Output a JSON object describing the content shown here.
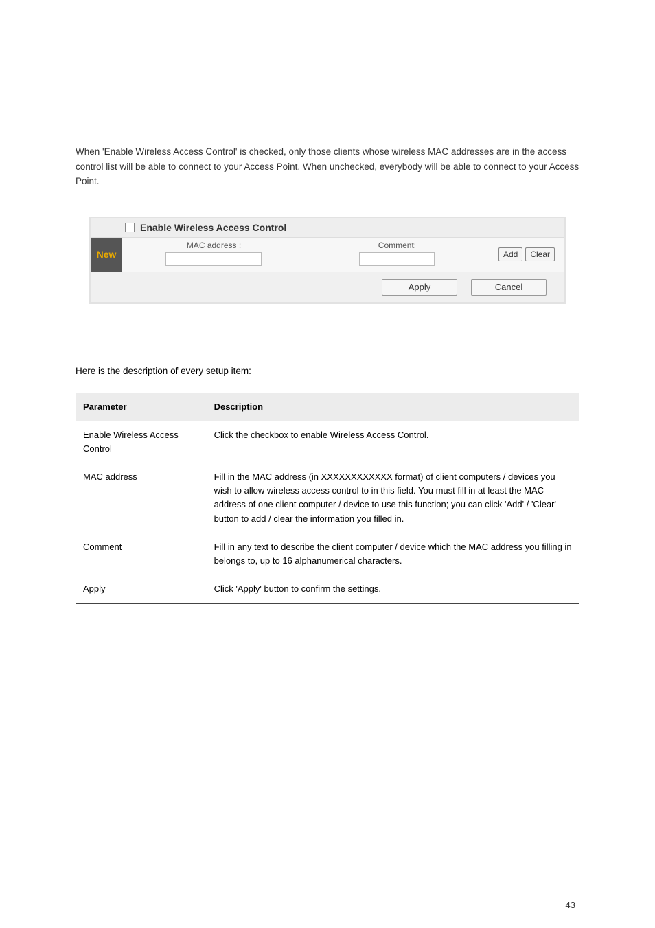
{
  "intro": "When 'Enable Wireless Access Control' is checked, only those clients whose wireless MAC addresses are in the access control list will be able to connect to your Access Point. When unchecked, everybody will be able to connect to your Access Point.",
  "ui": {
    "enable_label": "Enable Wireless Access Control",
    "new_label": "New",
    "mac_label": "MAC address :",
    "comment_label": "Comment:",
    "add_btn": "Add",
    "clear_btn": "Clear",
    "apply_btn": "Apply",
    "cancel_btn": "Cancel",
    "mac_value": "",
    "comment_value": ""
  },
  "param_intro": "Here is the description of every setup item:",
  "table": {
    "head_param": "Parameter",
    "head_desc": "Description",
    "rows": [
      {
        "param": "Enable Wireless Access Control",
        "desc": "Click the checkbox to enable Wireless Access Control."
      },
      {
        "param": "MAC address",
        "desc": "Fill in the MAC address (in XXXXXXXXXXXX format) of client computers / devices you wish to allow wireless access control to in this field. You must fill in at least the MAC address of one client computer / device to use this function; you can click 'Add' / 'Clear' button to add / clear the information you filled in."
      },
      {
        "param": "Comment",
        "desc": "Fill in any text to describe the client computer / device which the MAC address you filling in belongs to, up to 16 alphanumerical characters."
      },
      {
        "param": "Apply",
        "desc": "Click 'Apply' button to confirm the settings."
      }
    ]
  },
  "page_no": "43"
}
